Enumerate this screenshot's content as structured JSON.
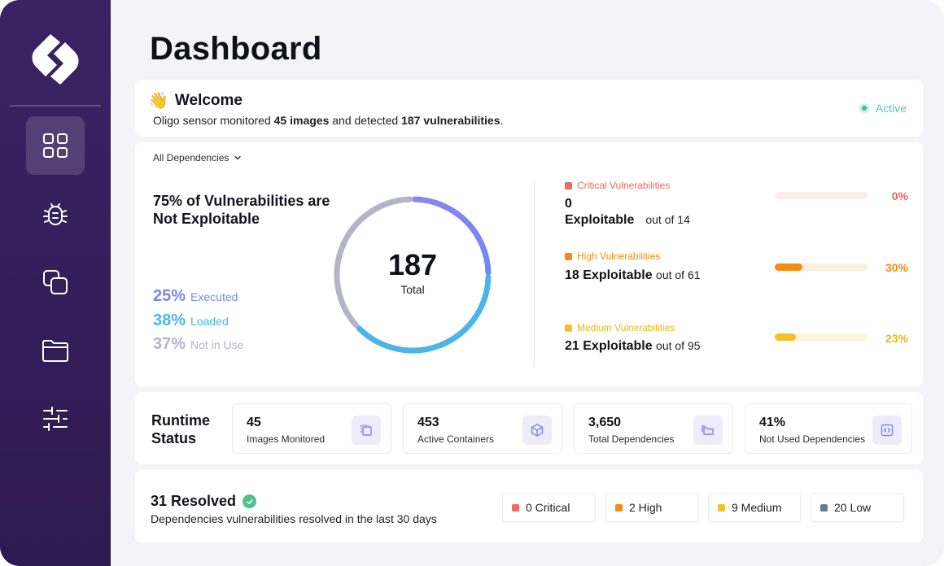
{
  "page": {
    "title": "Dashboard"
  },
  "sidebar": {
    "logo": "oligo-logo",
    "items": [
      {
        "icon": "grid-icon",
        "active": true
      },
      {
        "icon": "bug-icon",
        "active": false
      },
      {
        "icon": "copy-icon",
        "active": false
      },
      {
        "icon": "folder-icon",
        "active": false
      },
      {
        "icon": "sliders-icon",
        "active": false
      }
    ]
  },
  "welcome": {
    "emoji": "👋",
    "title": "Welcome",
    "desc_prefix": "Oligo sensor monitored ",
    "images": "45 images",
    "desc_middle": " and detected ",
    "vulnerabilities": "187 vulnerabilities",
    "desc_suffix": ".",
    "status": "Active"
  },
  "vulnerabilities": {
    "filter": "All Dependencies",
    "headline": "75% of Vulnerabilities are Not Exploitable",
    "total": "187",
    "total_label": "Total",
    "legend": [
      {
        "pct": "25%",
        "label": "Executed",
        "color": "#7f84f2"
      },
      {
        "pct": "38%",
        "label": "Loaded",
        "color": "#4bb5ea"
      },
      {
        "pct": "37%",
        "label": "Not in Use",
        "color": "#b4b3c8"
      }
    ],
    "donut_segments": [
      {
        "label": "Executed",
        "fraction": 0.25,
        "color": "#7f84f2"
      },
      {
        "label": "Loaded",
        "fraction": 0.38,
        "color": "#4bb5ea"
      },
      {
        "label": "Not in Use",
        "fraction": 0.37,
        "color": "#b4b3c8"
      }
    ],
    "severities": [
      {
        "label": "Critical  Vulnerabilities",
        "line1": "0",
        "line2": "Exploitable",
        "out_of": "out of 14",
        "pct": "0%",
        "fraction": 0.0,
        "color": "#f0685e",
        "track": "#fdecea"
      },
      {
        "label": "High Vulnerabilities",
        "line1": "18 Exploitable",
        "out_of": "out of 61",
        "pct": "30%",
        "fraction": 0.3,
        "color": "#f78a12",
        "track": "#fdefe0"
      },
      {
        "label": "Medium Vulnerabilities",
        "line1": "21 Exploitable",
        "out_of": "out of 95",
        "pct": "23%",
        "fraction": 0.23,
        "color": "#f5c023",
        "track": "#fdf4dc"
      }
    ]
  },
  "runtime": {
    "title_line1": "Runtime",
    "title_line2": "Status",
    "stats": [
      {
        "value": "45",
        "label": "Images Monitored",
        "icon": "layers-icon"
      },
      {
        "value": "453",
        "label": "Active Containers",
        "icon": "cube-icon"
      },
      {
        "value": "3,650",
        "label": "Total Dependencies",
        "icon": "folders-icon"
      },
      {
        "value": "41%",
        "label": "Not Used Dependencies",
        "icon": "code-icon"
      }
    ]
  },
  "resolved": {
    "title": "31 Resolved",
    "desc": "Dependencies vulnerabilities resolved in the last 30 days",
    "chips": [
      {
        "label": "0 Critical",
        "color": "#f0685e"
      },
      {
        "label": "2 High",
        "color": "#f78a12"
      },
      {
        "label": "9 Medium",
        "color": "#f5c023"
      },
      {
        "label": "20 Low",
        "color": "#6b7c88"
      }
    ]
  }
}
